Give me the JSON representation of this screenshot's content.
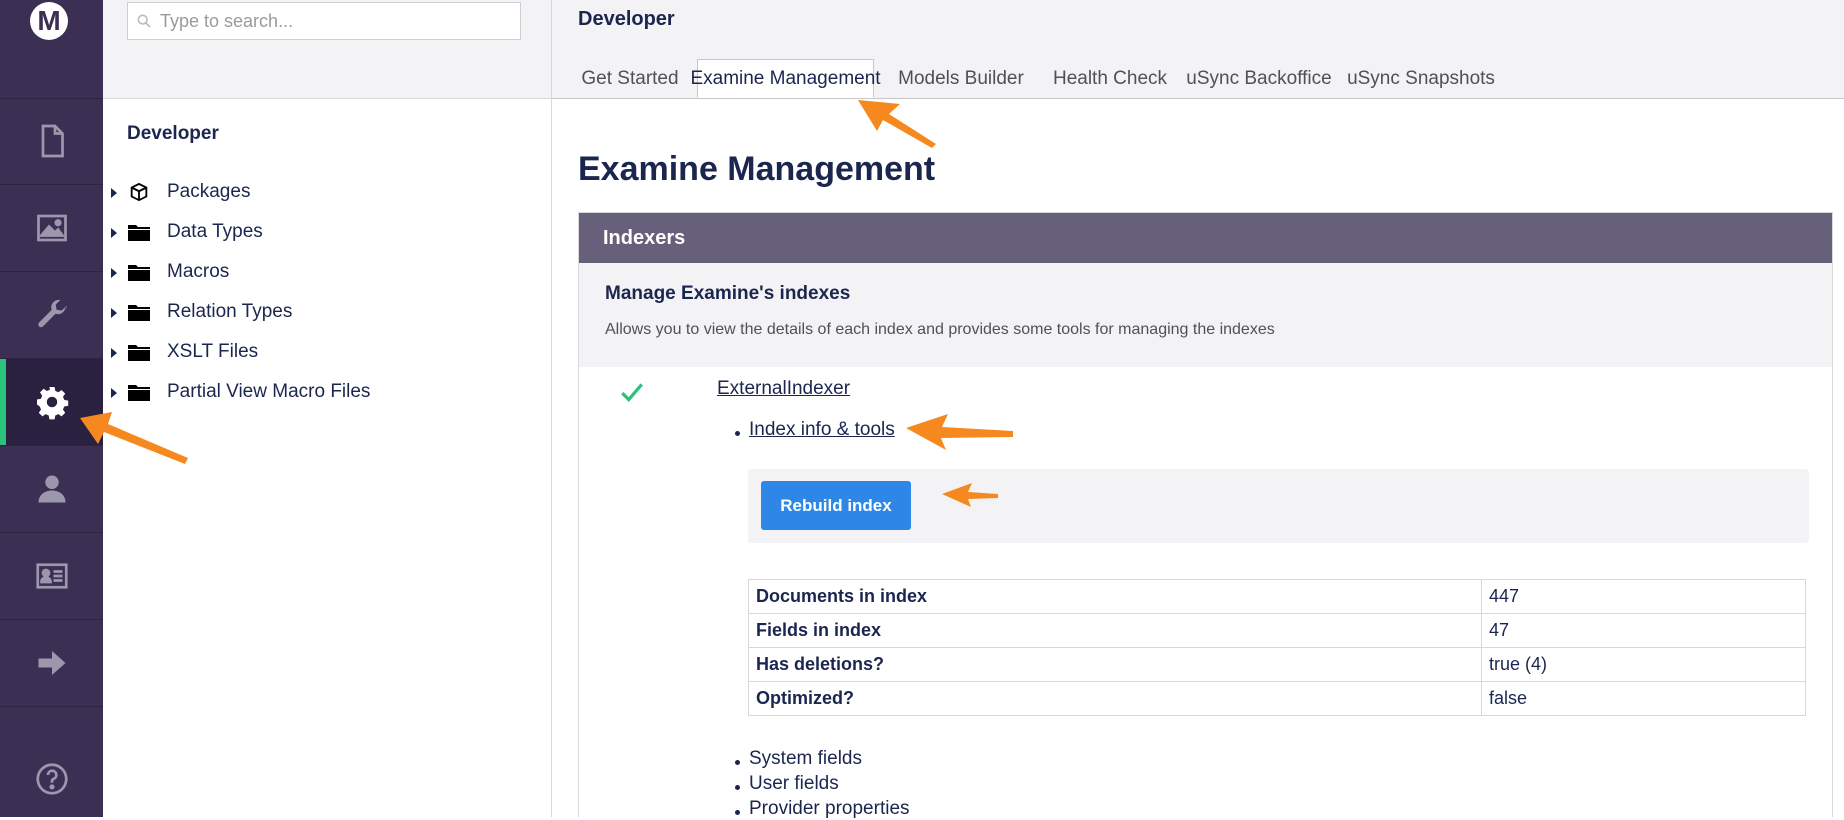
{
  "rail": {
    "logo": "M",
    "items": [
      {
        "name": "content",
        "icon": "document-icon"
      },
      {
        "name": "media",
        "icon": "image-icon"
      },
      {
        "name": "settings",
        "icon": "wrench-icon"
      },
      {
        "name": "developer",
        "icon": "gear-icon",
        "active": true
      },
      {
        "name": "users",
        "icon": "user-icon"
      },
      {
        "name": "members",
        "icon": "id-card-icon"
      },
      {
        "name": "forms",
        "icon": "arrow-right-icon"
      }
    ],
    "help_icon": "help-icon"
  },
  "tree": {
    "search_placeholder": "Type to search...",
    "title": "Developer",
    "items": [
      {
        "label": "Packages",
        "icon": "package-icon"
      },
      {
        "label": "Data Types",
        "icon": "folder-icon"
      },
      {
        "label": "Macros",
        "icon": "folder-icon"
      },
      {
        "label": "Relation Types",
        "icon": "folder-icon"
      },
      {
        "label": "XSLT Files",
        "icon": "folder-icon"
      },
      {
        "label": "Partial View Macro Files",
        "icon": "folder-icon"
      }
    ]
  },
  "main": {
    "section_title": "Developer",
    "tabs": [
      {
        "label": "Get Started"
      },
      {
        "label": "Examine Management",
        "active": true
      },
      {
        "label": "Models Builder"
      },
      {
        "label": "Health Check"
      },
      {
        "label": "uSync Backoffice"
      },
      {
        "label": "uSync Snapshots"
      }
    ],
    "page_title": "Examine Management",
    "panel": {
      "header": "Indexers",
      "sub_title": "Manage Examine's indexes",
      "sub_desc": "Allows you to view the details of each index and provides some tools for managing the indexes",
      "indexer": {
        "name": "ExternalIndexer",
        "tools_link": "Index info & tools",
        "rebuild_label": "Rebuild index",
        "stats": [
          {
            "key": "Documents in index",
            "value": "447"
          },
          {
            "key": "Fields in index",
            "value": "47"
          },
          {
            "key": "Has deletions?",
            "value": "true (4)"
          },
          {
            "key": "Optimized?",
            "value": "false"
          }
        ],
        "fields": [
          "System fields",
          "User fields",
          "Provider properties"
        ]
      }
    }
  },
  "colors": {
    "rail_bg": "#3b2f54",
    "active_indicator": "#2bc37c",
    "panel_header": "#67607a",
    "button_blue": "#2e87e6",
    "annotation_orange": "#f5891f"
  }
}
